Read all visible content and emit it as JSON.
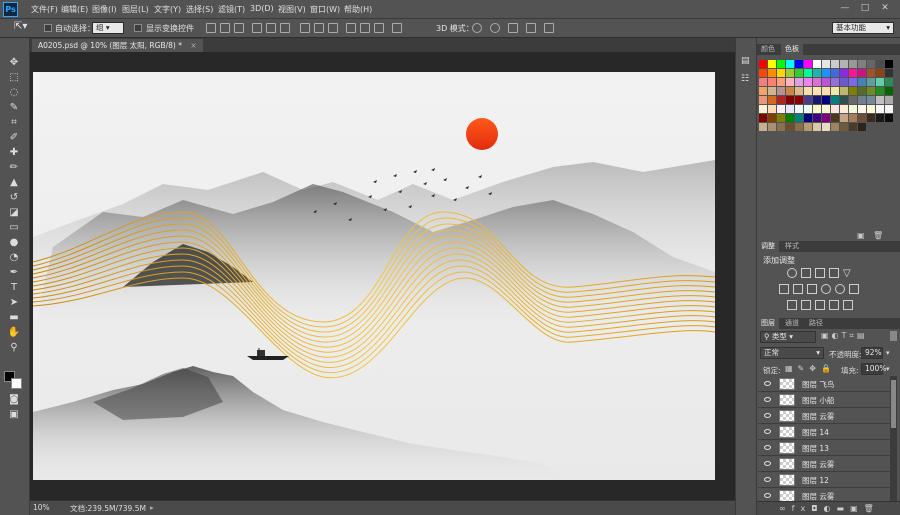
{
  "app": {
    "logo": "Ps",
    "accent": "#31a8ff"
  },
  "menu": [
    "文件(F)",
    "编辑(E)",
    "图像(I)",
    "图层(L)",
    "文字(Y)",
    "选择(S)",
    "滤镜(T)",
    "3D(D)",
    "视图(V)",
    "窗口(W)",
    "帮助(H)"
  ],
  "window_controls": {
    "minimize": "—",
    "maximize": "□",
    "close": "✕"
  },
  "options": {
    "auto_select_label": "自动选择：",
    "auto_select_value": "组",
    "show_transform_label": "显示变换控件",
    "mode3d_label": "3D 模式：",
    "workspace": "基本功能"
  },
  "document": {
    "tab_title": "A0205.psd @ 10% (图层 太阳, RGB/8) *",
    "close": "×"
  },
  "status": {
    "zoom": "10%",
    "doc_size": "文档:239.5M/739.5M"
  },
  "color_panel": {
    "tabs": [
      "颜色",
      "色板"
    ],
    "active": 1
  },
  "adjust_panel": {
    "tabs": [
      "调整",
      "样式"
    ],
    "title": "添加调整"
  },
  "layers_panel": {
    "tabs": [
      "图层",
      "通道",
      "路径"
    ],
    "filter": "类型",
    "blend_mode": "正常",
    "opacity_label": "不透明度:",
    "opacity": "92%",
    "lock_label": "锁定:",
    "fill_label": "填充:",
    "fill": "100%",
    "layers": [
      "图层 飞鸟",
      "图层 小船",
      "图层 云雾",
      "图层 14",
      "图层 13",
      "图层 云雾",
      "图层 12",
      "图层 云雾"
    ]
  },
  "colors": {
    "swatches": [
      "#ff0000",
      "#ffff00",
      "#00ff00",
      "#00ffff",
      "#0000ff",
      "#ff00ff",
      "#ffffff",
      "#e6e6e6",
      "#cccccc",
      "#b3b3b3",
      "#999999",
      "#808080",
      "#666666",
      "#4d4d4d",
      "#000000",
      "#ff4500",
      "#ff8c00",
      "#ffd700",
      "#9acd32",
      "#32cd32",
      "#00fa9a",
      "#20b2aa",
      "#1e90ff",
      "#4169e1",
      "#8a2be2",
      "#ff1493",
      "#c71585",
      "#a0522d",
      "#8b4513",
      "#333333",
      "#f08080",
      "#fa8072",
      "#ffa07a",
      "#ffb6c1",
      "#dda0dd",
      "#ee82ee",
      "#da70d6",
      "#ba55d3",
      "#9370db",
      "#6a5acd",
      "#7b68ee",
      "#4682b4",
      "#5f9ea0",
      "#66cdaa",
      "#2e8b57",
      "#f4a460",
      "#d2b48c",
      "#bc8f8f",
      "#cd853f",
      "#deb887",
      "#f5deb3",
      "#ffe4b5",
      "#ffdead",
      "#eee8aa",
      "#bdb76b",
      "#808000",
      "#556b2f",
      "#6b8e23",
      "#228b22",
      "#006400",
      "#e9967a",
      "#d2691e",
      "#b22222",
      "#800000",
      "#8b0000",
      "#483d8b",
      "#191970",
      "#000080",
      "#008080",
      "#2f4f4f",
      "#696969",
      "#708090",
      "#778899",
      "#c0c0c0",
      "#a9a9a9",
      "#ffefd5",
      "#ffdab9",
      "#fff0f5",
      "#e6e6fa",
      "#f0f8ff",
      "#f0fff0",
      "#fffacd",
      "#fafad2",
      "#ffe4e1",
      "#faebd7",
      "#f5f5dc",
      "#fdf5e6",
      "#fff8dc",
      "#f8f8ff",
      "#f5f5f5",
      "#7f0000",
      "#7f3f00",
      "#7f7f00",
      "#007f00",
      "#007f7f",
      "#00007f",
      "#3f007f",
      "#7f007f",
      "#4b3621",
      "#c4a484",
      "#a67b5b",
      "#6f4e37",
      "#3d2b1f",
      "#1a1a1a",
      "#0d0d0d",
      "#c8b090",
      "#a89070",
      "#887050",
      "#685030",
      "#8a6e4a",
      "#b89a6e",
      "#d8c8a8",
      "#e8dcc8",
      "#9c8463",
      "#6e5a3c",
      "#4a3c28",
      "#2c2418"
    ]
  }
}
